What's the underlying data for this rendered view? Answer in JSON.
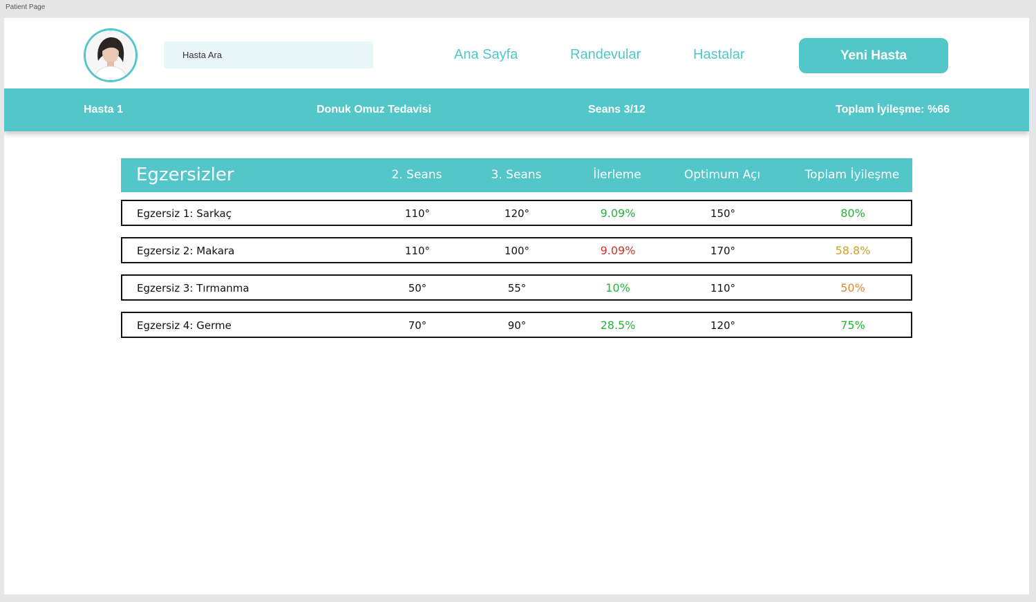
{
  "window": {
    "frame_label": "Patient Page"
  },
  "header": {
    "search_placeholder": "Hasta Ara",
    "nav": [
      "Ana Sayfa",
      "Randevular",
      "Hastalar"
    ],
    "new_patient_label": "Yeni Hasta"
  },
  "patient_bar": {
    "name": "Hasta 1",
    "treatment": "Donuk Omuz Tedavisi",
    "session": "Seans 3/12",
    "total_improvement": "Toplam İyileşme: %66"
  },
  "table": {
    "title": "Egzersizler",
    "columns": [
      "2. Seans",
      "3. Seans",
      "İlerleme",
      "Optimum Açı",
      "Toplam İyileşme"
    ],
    "rows": [
      {
        "name": "Egzersiz 1: Sarkaç",
        "s2": "110°",
        "s3": "120°",
        "progress": "9.09%",
        "progress_color": "#27b33b",
        "optimum": "150°",
        "total": "80%",
        "total_color": "#27b33b"
      },
      {
        "name": "Egzersiz 2: Makara",
        "s2": "110°",
        "s3": "100°",
        "progress": "9.09%",
        "progress_color": "#d0312d",
        "optimum": "170°",
        "total": "58.8%",
        "total_color": "#c9a227"
      },
      {
        "name": "Egzersiz 3: Tırmanma",
        "s2": "50°",
        "s3": "55°",
        "progress": "10%",
        "progress_color": "#27b33b",
        "optimum": "110°",
        "total": "50%",
        "total_color": "#d9883a"
      },
      {
        "name": "Egzersiz 4: Germe",
        "s2": "70°",
        "s3": "90°",
        "progress": "28.5%",
        "progress_color": "#27b33b",
        "optimum": "120°",
        "total": "75%",
        "total_color": "#27b33b"
      }
    ]
  },
  "colors": {
    "accent": "#52c6c9",
    "search_bg": "#eaf7f8"
  }
}
